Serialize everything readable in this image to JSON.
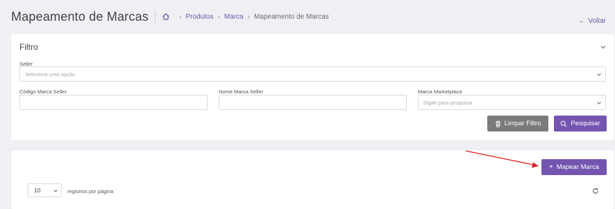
{
  "header": {
    "title": "Mapeamento de Marcas",
    "breadcrumb": [
      "Produtos",
      "Marca",
      "Mapeamento de Marcas"
    ],
    "back_label": "Voltar",
    "back_icon": "arrow-left-icon",
    "home_icon": "home-icon"
  },
  "filter": {
    "title": "Filtro",
    "seller_label": "Seller",
    "seller_placeholder": "Selecione uma opção",
    "codigo_label": "Código Marca Seller",
    "codigo_value": "",
    "nome_label": "Nome Marca Seller",
    "nome_value": "",
    "marketplace_label": "Marca Marketplace",
    "marketplace_placeholder": "Digite para pesquisar",
    "clear_label": "Limpar Filtro",
    "search_label": "Pesquisar"
  },
  "list": {
    "map_button_label": "Mapear Marca",
    "page_length": "10",
    "page_length_label": "registros por página"
  },
  "colors": {
    "accent": "#7455b0",
    "link": "#6a5aa8",
    "grey_button": "#7b7b7b",
    "annotation_arrow": "#e02020"
  }
}
